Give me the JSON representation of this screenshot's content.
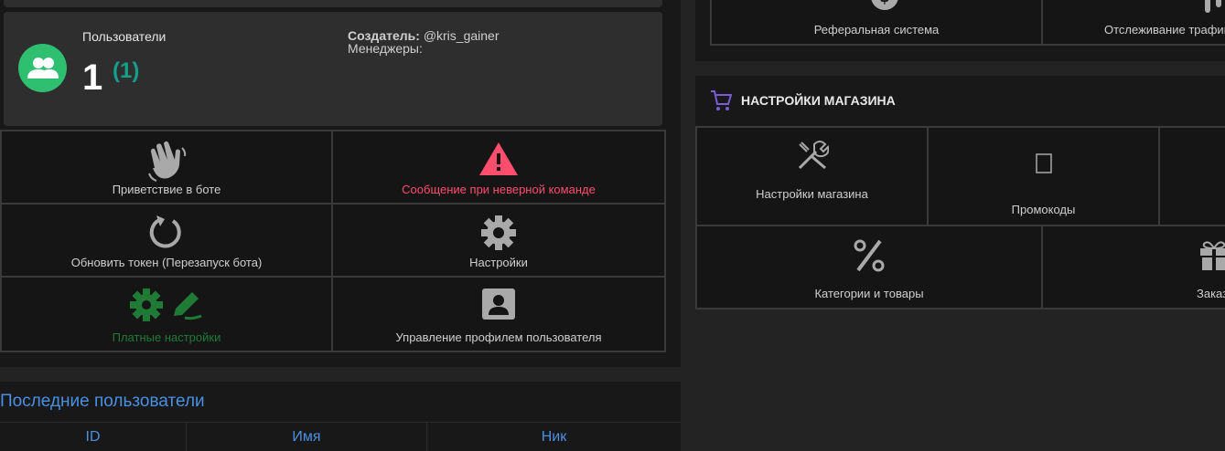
{
  "stats": {
    "users_label": "Пользователи",
    "users_count": "1",
    "users_new": "(1)",
    "creator_label": "Создатель:",
    "creator_value": "@kris_gainer",
    "managers_label": "Менеджеры:"
  },
  "bot_tiles": [
    {
      "label": "Приветствие в боте",
      "icon": "waving-hand-icon"
    },
    {
      "label": "Сообщение при неверной команде",
      "icon": "warning-icon",
      "color": "#ff4d6d"
    },
    {
      "label": "Обновить токен (Перезапуск бота)",
      "icon": "refresh-icon"
    },
    {
      "label": "Настройки",
      "icon": "gear-icon"
    },
    {
      "label": "Платные настройки",
      "icon": "gear-pencil-icon",
      "color": "#1f7a36"
    },
    {
      "label": "Управление профилем пользователя",
      "icon": "user-profile-icon"
    }
  ],
  "latest_users": {
    "title": "Последние пользователи",
    "columns": [
      "ID",
      "Имя",
      "Ник"
    ]
  },
  "right_top_tiles": [
    {
      "label": "Реферальная система",
      "icon": "dollar-icon"
    },
    {
      "label": "Отслеживание трафика",
      "icon": "tracking-icon"
    }
  ],
  "shop": {
    "title": "НАСТРОЙКИ МАГАЗИНА",
    "tiles": [
      {
        "label": "Настройки магазина",
        "icon": "tools-icon"
      },
      {
        "label": "Промокоды",
        "icon": "promo-icon"
      },
      {
        "label": "",
        "icon": "blank-icon"
      },
      {
        "label": "Категории и товары",
        "icon": "percent-icon"
      },
      {
        "label": "Заказ",
        "icon": "gift-icon"
      }
    ]
  },
  "colors": {
    "accent_blue": "#4a90e2",
    "users_green": "#2fbf71",
    "new_teal": "#159f8a",
    "warning_red": "#ff4d6d",
    "paid_green": "#1f7a36",
    "cart_purple": "#7b5cd6"
  }
}
